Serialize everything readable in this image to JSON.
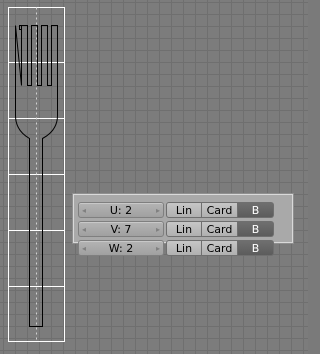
{
  "viewport": {
    "icons": [
      "fork-mesh-icon",
      "lattice-cage-icon"
    ]
  },
  "lattice_panel": {
    "rows": [
      {
        "field": "U: 2",
        "interp": [
          "Lin",
          "Card",
          "B"
        ]
      },
      {
        "field": "V: 7",
        "interp": [
          "Lin",
          "Card",
          "B"
        ]
      },
      {
        "field": "W: 2",
        "interp": [
          "Lin",
          "Card",
          "B"
        ]
      }
    ],
    "arrow_left": "◂",
    "arrow_right": "▸"
  },
  "colors": {
    "grid_bg": "#7c7c7c",
    "grid_line": "#6f6f6f",
    "lattice_line": "#ffffff",
    "mesh_line": "#000000",
    "button_active": "#6a6a6a"
  }
}
